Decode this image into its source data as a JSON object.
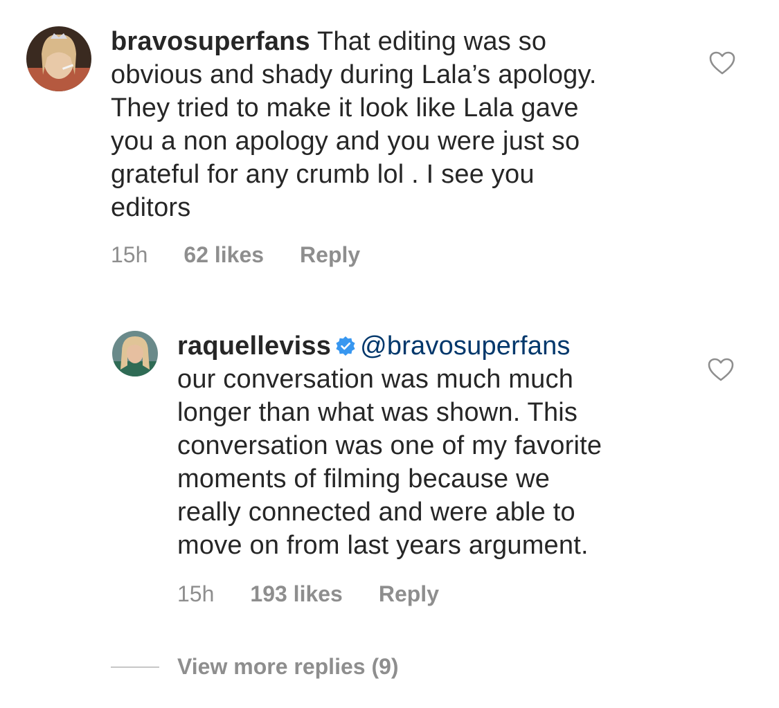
{
  "comments": [
    {
      "username": "bravosuperfans",
      "text_first": "That editing was so",
      "lines": [
        "obvious and shady during Lala’s apology.",
        "They tried to make it look like Lala gave",
        "you a non apology and you were just so",
        "grateful for any crumb lol . I see you",
        "editors"
      ],
      "time": "15h",
      "likes": "62 likes",
      "reply_label": "Reply",
      "avatar_icon": "user-avatar"
    },
    {
      "username": "raquelleviss",
      "verified_icon": "verified-badge-icon",
      "mention": "@bravosuperfans",
      "lines": [
        "our conversation was much much",
        "longer than what was shown. This",
        "conversation was one of my favorite",
        "moments of filming because we",
        "really connected and were able to",
        "move on from last years argument."
      ],
      "time": "15h",
      "likes": "193 likes",
      "reply_label": "Reply",
      "avatar_icon": "user-avatar"
    }
  ],
  "view_more_label": "View more replies (9)",
  "colors": {
    "text": "#262626",
    "muted": "#8e8e8e",
    "mention": "#00376b",
    "verified": "#3897f0"
  }
}
